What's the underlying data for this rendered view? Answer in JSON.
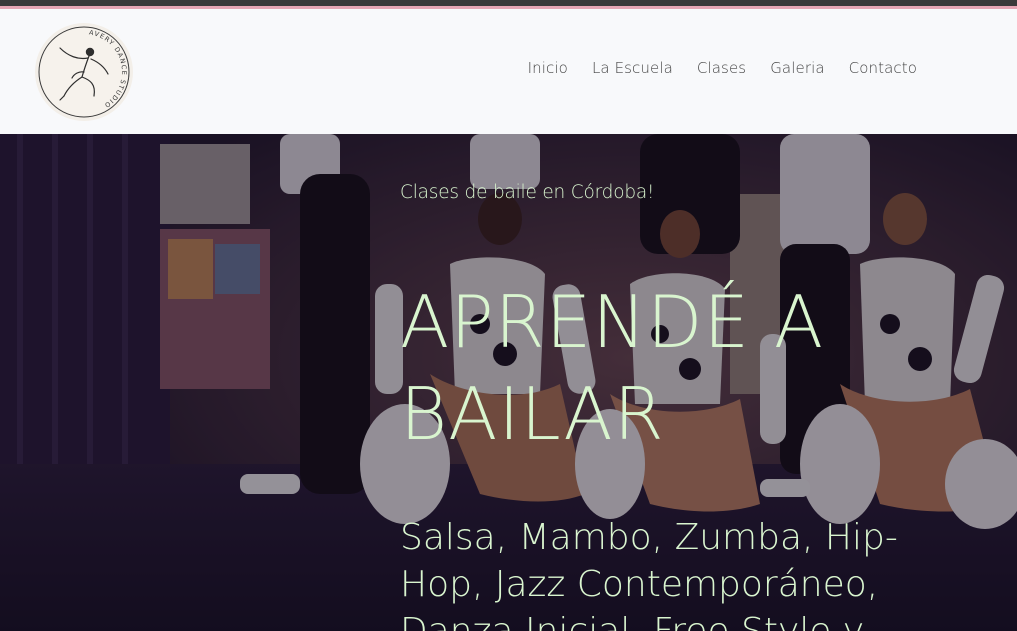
{
  "brand": {
    "logo_text": "AVERY DANCE STUDIO",
    "logo_icon": "dancer-icon"
  },
  "nav": {
    "items": [
      {
        "label": "Inicio"
      },
      {
        "label": "La Escuela"
      },
      {
        "label": "Clases"
      },
      {
        "label": "Galeria"
      },
      {
        "label": "Contacto"
      }
    ]
  },
  "hero": {
    "kicker": "Clases de baile en Córdoba!",
    "headline": "APRENDÉ A BAILAR",
    "subhead": "Salsa, Mambo, Zumba, Hip-Hop, Jazz Contemporáneo, Danza Inicial, Free Style y"
  },
  "colors": {
    "accent_text": "#d9f5cf",
    "top_border": "#e6a6b5",
    "header_bg": "#f8f9fb"
  }
}
